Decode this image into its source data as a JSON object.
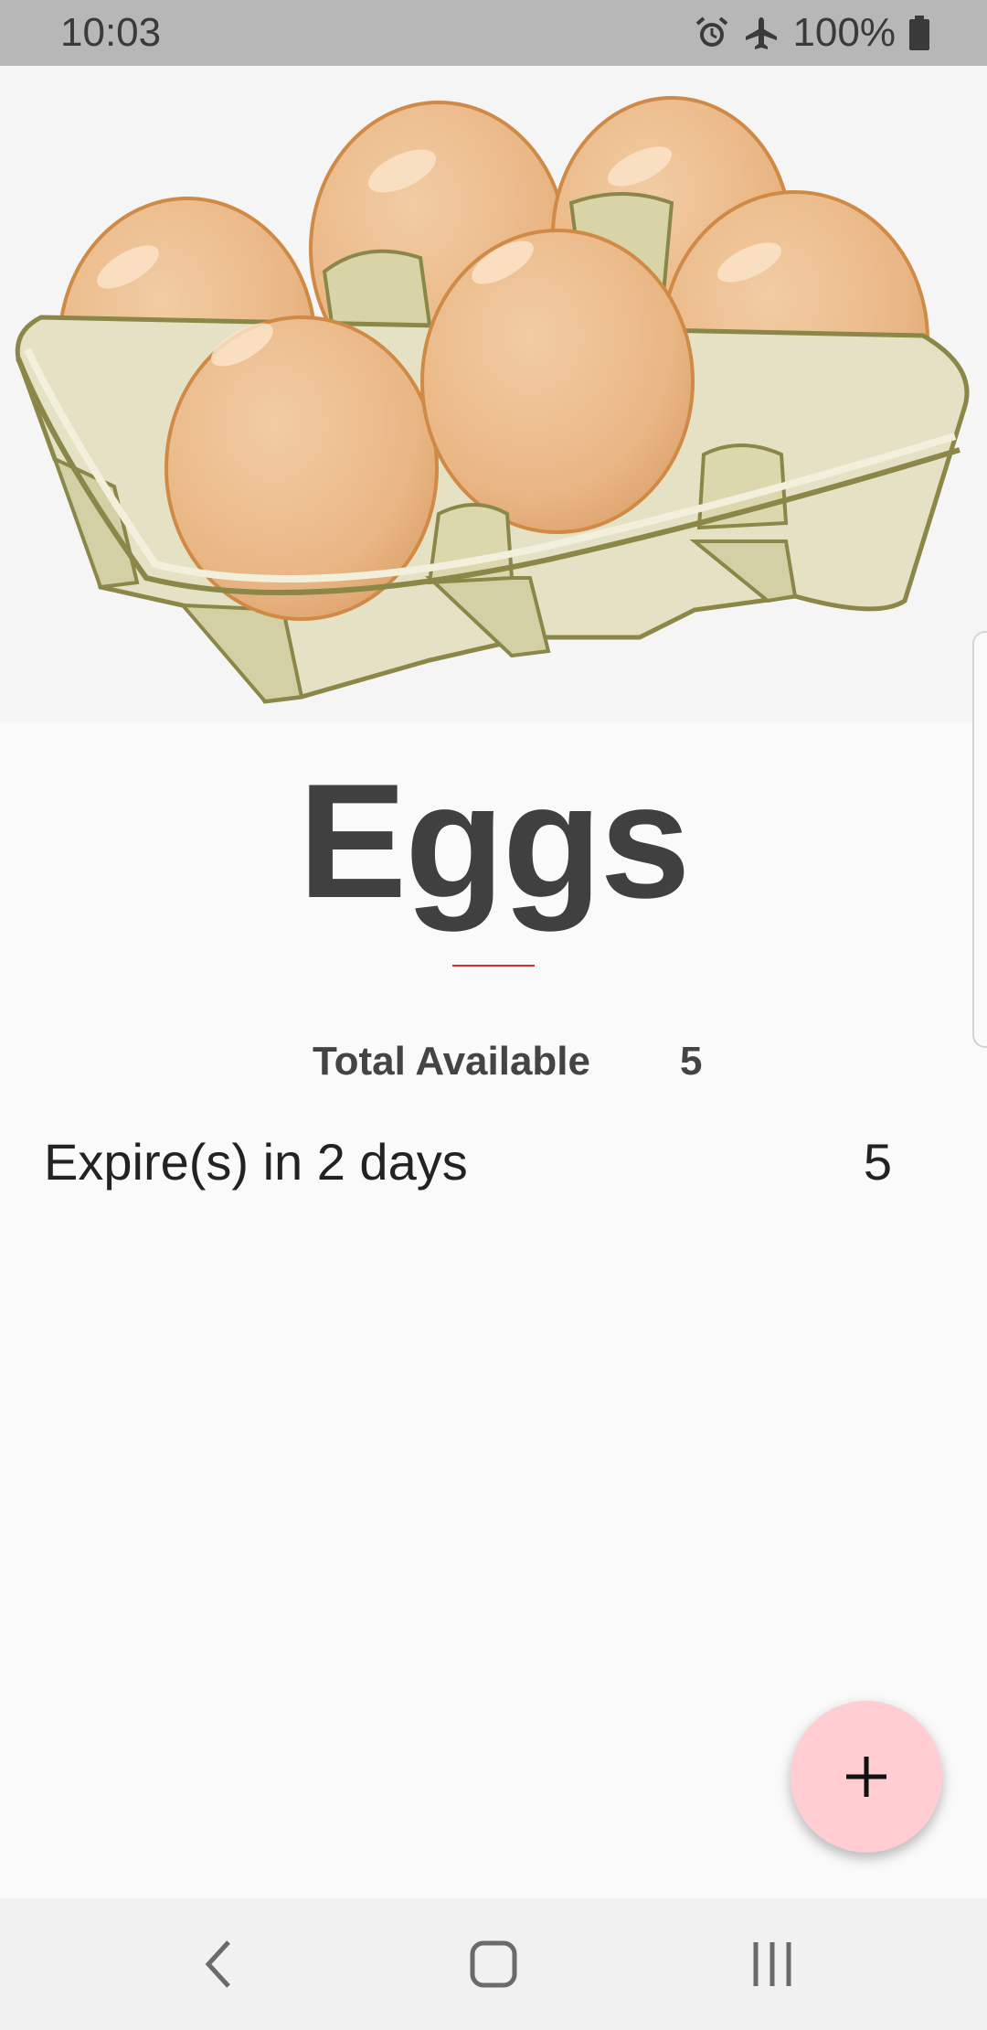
{
  "status_bar": {
    "time": "10:03",
    "battery": "100%",
    "icons": [
      "alarm-icon",
      "airplane-mode-icon",
      "battery-full-icon"
    ]
  },
  "product": {
    "image": "egg-carton-illustration",
    "name": "Eggs",
    "total_label": "Total Available",
    "total_value": "5"
  },
  "expirations": [
    {
      "label": "Expire(s) in 2 days",
      "count": "5"
    }
  ],
  "fab": {
    "icon": "plus-icon"
  },
  "nav_bar": {
    "icons": [
      "back-icon",
      "home-icon",
      "recent-apps-icon"
    ]
  },
  "colors": {
    "status_bar": "#b7b7b7",
    "title": "#404040",
    "divider_accent": "#d32f2f",
    "fab": "#ffcdd2",
    "egg": "#eab583",
    "carton": "#e2dfc2"
  }
}
